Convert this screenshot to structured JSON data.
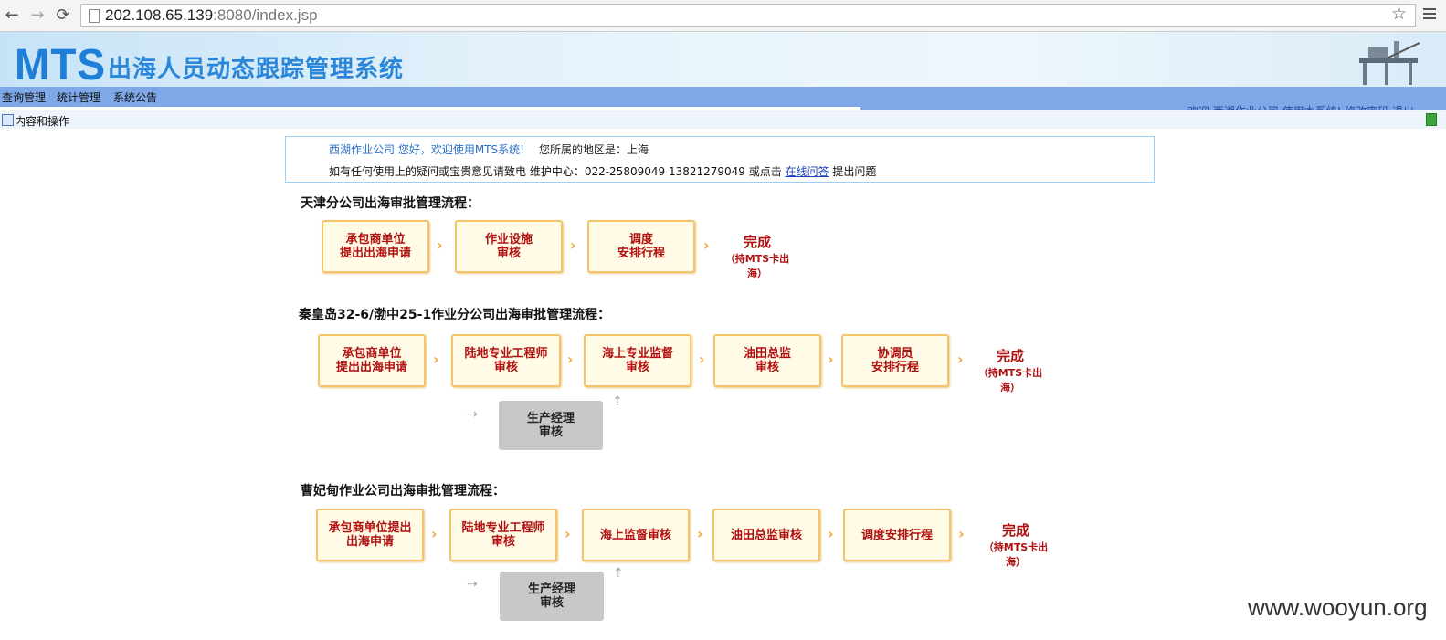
{
  "browser": {
    "url_host": "202.108.65.139",
    "url_rest": ":8080/index.jsp"
  },
  "header": {
    "logo": "MTS",
    "title": "出海人员动态跟踪管理系统"
  },
  "menu": [
    "查询管理",
    "统计管理",
    "系统公告"
  ],
  "scroll_message": "欢迎 西湖作业公司 使用本系统! 修改密码 退出",
  "content_label": "内容和操作",
  "info": {
    "welcome": "西湖作业公司 您好，欢迎使用MTS系统!",
    "region": "您所属的地区是：上海",
    "contact_prefix": "如有任何使用上的疑问或宝贵意见请致电 维护中心：022-25809049 13821279049 或点击",
    "contact_link": "在线问答",
    "contact_suffix": "提出问题"
  },
  "flows": [
    {
      "title": "天津分公司出海审批管理流程：",
      "steps": [
        "承包商单位\n提出出海申请",
        "作业设施\n审核",
        "调度\n安排行程"
      ],
      "done": "完成",
      "done_note": "（持MTS卡出海）"
    },
    {
      "title": "秦皇岛32-6/渤中25-1作业分公司出海审批管理流程：",
      "steps": [
        "承包商单位\n提出出海申请",
        "陆地专业工程师\n审核",
        "海上专业监督\n审核",
        "油田总监\n审核",
        "协调员\n安排行程"
      ],
      "branch": "生产经理\n审核",
      "done": "完成",
      "done_note": "（持MTS卡出海）"
    },
    {
      "title": "曹妃甸作业公司出海审批管理流程：",
      "steps": [
        "承包商单位提出\n出海申请",
        "陆地专业工程师\n审核",
        "海上监督审核",
        "油田总监审核",
        "调度安排行程"
      ],
      "branch": "生产经理\n审核",
      "done": "完成",
      "done_note": "（持MTS卡出海）"
    }
  ],
  "watermark": "www.wooyun.org",
  "colors": {
    "accent": "#1e7fd6",
    "menubar": "#7fa8e8",
    "step_border": "#f5c36a",
    "step_text": "#b01010"
  }
}
